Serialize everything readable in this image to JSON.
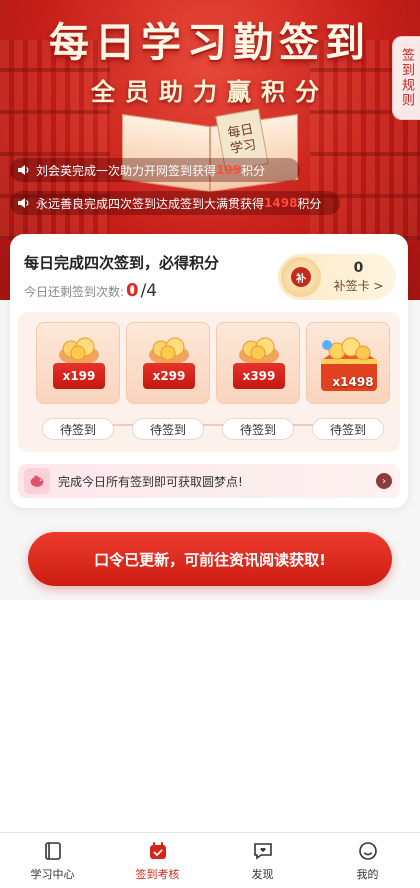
{
  "banner": {
    "title": "每日学习勤签到",
    "subtitle": "全员助力赢积分",
    "book_tag": "每日学习",
    "rules_tab": "签到规则",
    "tickers": [
      {
        "before": "刘会英完成一次助力开网签到获得",
        "points": "199",
        "after": "积分"
      },
      {
        "before": "永远善良完成四次签到达成签到大满贯获得",
        "points": "1498",
        "after": "积分"
      }
    ]
  },
  "checkin": {
    "title": "每日完成四次签到，必得积分",
    "remaining_label": "今日还剩签到次数:",
    "remaining_count": "0",
    "remaining_total": "/4",
    "makeup_count": "0",
    "makeup_label": "补签卡 >",
    "makeup_badge": "补",
    "rewards": [
      {
        "amount": "x199",
        "status": "待签到"
      },
      {
        "amount": "x299",
        "status": "待签到"
      },
      {
        "amount": "x399",
        "status": "待签到"
      },
      {
        "amount": "x1498",
        "status": "待签到"
      }
    ],
    "hint_text": "完成今日所有签到即可获取圆梦点!"
  },
  "cta_label": "口令已更新，可前往资讯阅读获取!",
  "nav": [
    {
      "label": "学习中心",
      "icon": "book-icon"
    },
    {
      "label": "签到考核",
      "icon": "calendar-check-icon"
    },
    {
      "label": "发现",
      "icon": "message-heart-icon"
    },
    {
      "label": "我的",
      "icon": "smile-icon"
    }
  ],
  "colors": {
    "brand_red": "#d8251a",
    "banner_red": "#c8201a"
  }
}
